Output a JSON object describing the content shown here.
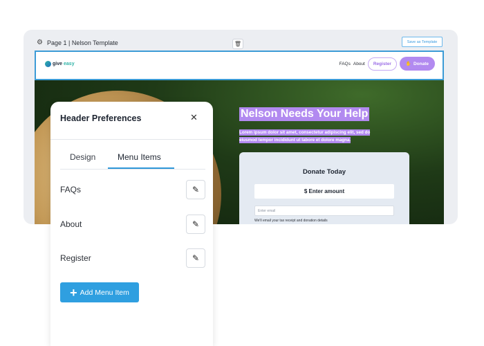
{
  "editor": {
    "page_title": "Page 1 | Nelson Template",
    "save_template_label": "Save as Template"
  },
  "site_header": {
    "logo_give": "give",
    "logo_easy": "easy",
    "nav": {
      "faqs": "FAQs",
      "about": "About",
      "register": "Register",
      "donate": "Donate"
    }
  },
  "hero": {
    "title": "Nelson Needs Your Help",
    "line1": "Lorem ipsum dolor sit amet, consectetur adipiscing elit, sed do",
    "line2": "eiusmod tempor incididunt ut labore et dolore magna.",
    "donate_card": {
      "title": "Donate Today",
      "amount_placeholder": "$ Enter amount",
      "email_placeholder": "Enter email",
      "note": "We'll email your tax receipt and donation details"
    }
  },
  "header_preferences": {
    "title": "Header Preferences",
    "tabs": [
      {
        "label": "Design",
        "active": false
      },
      {
        "label": "Menu Items",
        "active": true
      }
    ],
    "menu_items": [
      {
        "label": "FAQs"
      },
      {
        "label": "About"
      },
      {
        "label": "Register"
      }
    ],
    "add_button_label": "Add Menu Item"
  },
  "colors": {
    "accent_blue": "#2f9fe0",
    "brand_purple": "#b28af0"
  }
}
